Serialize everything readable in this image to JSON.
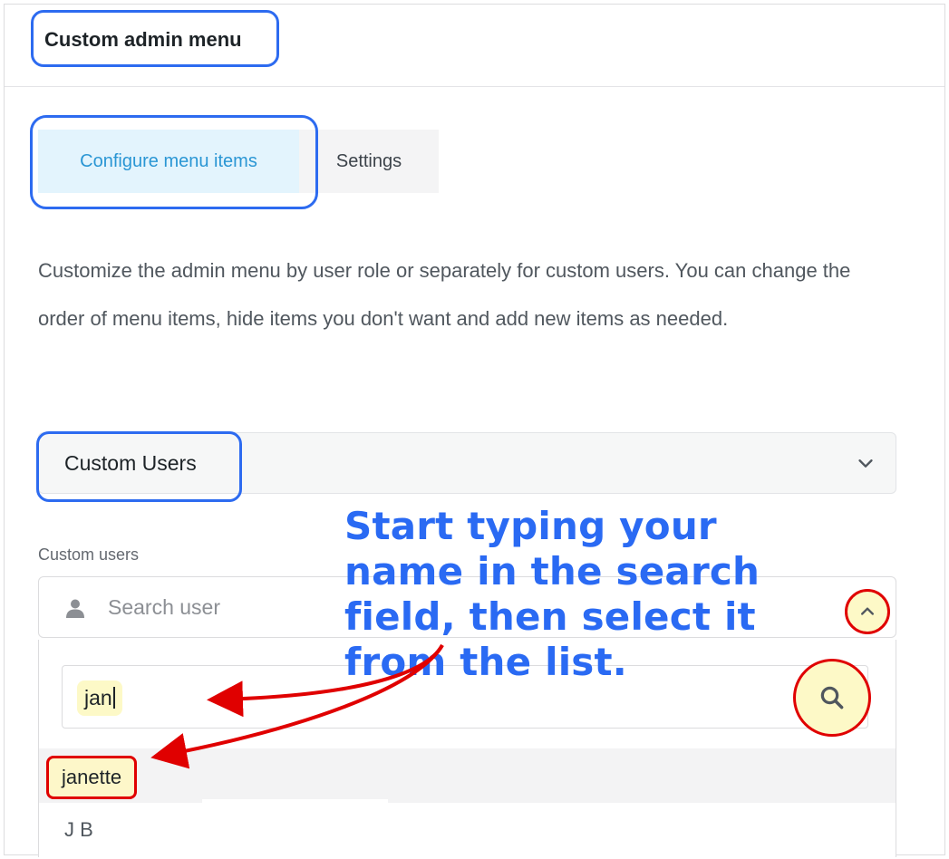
{
  "page": {
    "title": "Custom admin menu"
  },
  "tabs": [
    {
      "label": "Configure menu items",
      "active": true
    },
    {
      "label": "Settings",
      "active": false
    }
  ],
  "description": "Customize the admin menu by user role or separately for custom users. You can change the order of menu items, hide items you don't want and add new items as needed.",
  "role_select": {
    "value": "Custom Users",
    "icon": "chevron-down-icon"
  },
  "custom_users": {
    "label": "Custom users",
    "placeholder": "Search user",
    "user_icon": "user-icon",
    "toggle_icon": "chevron-up-icon",
    "search": {
      "value": "jan",
      "icon": "search-icon"
    },
    "results": [
      {
        "name": "janette"
      },
      {
        "name": "J B"
      }
    ]
  },
  "annotation": {
    "callout": "Start typing your name in the search field, then select it from the list.",
    "highlight_color": "#2d6bf0",
    "arrow_color": "#e00000",
    "marker_color": "#fdf9c7"
  }
}
